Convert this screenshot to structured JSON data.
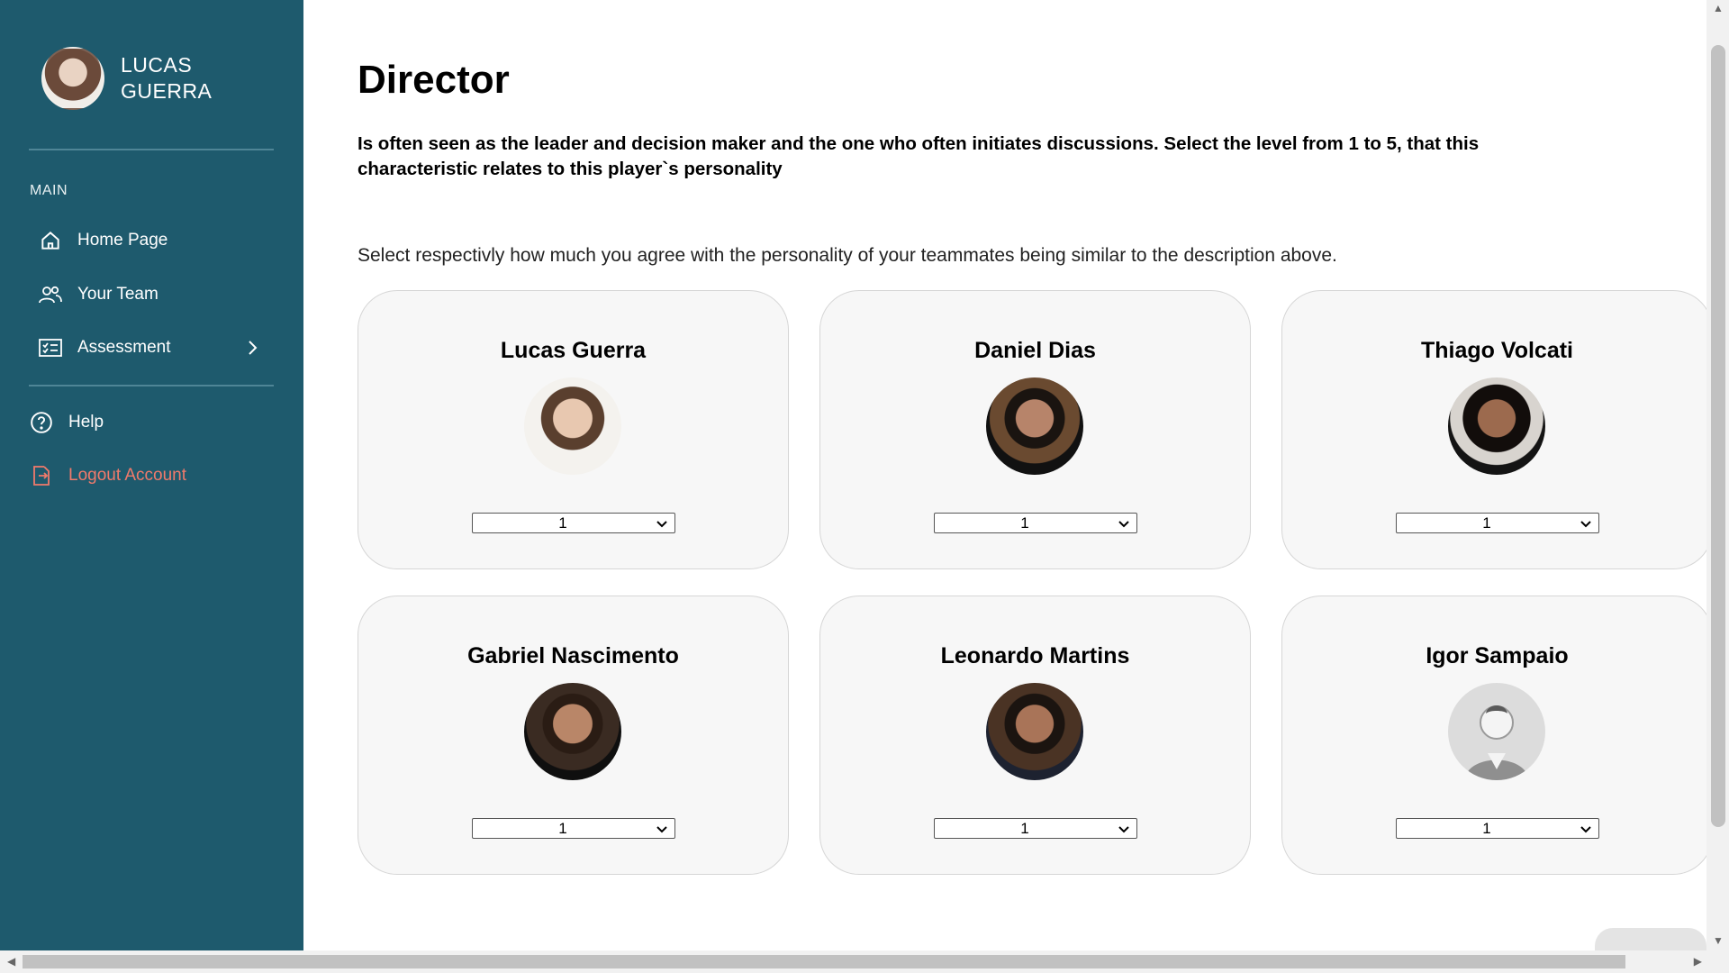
{
  "user": {
    "name": "LUCAS\nGUERRA"
  },
  "sidebar": {
    "section_label": "MAIN",
    "items": [
      {
        "label": "Home Page",
        "icon": "home-icon"
      },
      {
        "label": "Your Team",
        "icon": "team-icon"
      },
      {
        "label": "Assessment",
        "icon": "assessment-icon"
      },
      {
        "label": "Help",
        "icon": "help-icon"
      },
      {
        "label": "Logout Account",
        "icon": "logout-icon"
      }
    ]
  },
  "page": {
    "title": "Director",
    "description": "Is often seen as the leader and decision maker and the one who often initiates discussions. Select the level from 1 to 5, that this characteristic relates to this player`s personality",
    "instruction": "Select respectivly how much you agree with the personality of your teammates being similar to the description above."
  },
  "players": [
    {
      "name": "Lucas Guerra",
      "level": "1"
    },
    {
      "name": "Daniel Dias",
      "level": "1"
    },
    {
      "name": "Thiago Volcati",
      "level": "1"
    },
    {
      "name": "Gabriel Nascimento",
      "level": "1"
    },
    {
      "name": "Leonardo Martins",
      "level": "1"
    },
    {
      "name": "Igor Sampaio",
      "level": "1"
    }
  ],
  "colors": {
    "sidebar": "#1e5a6d",
    "logout": "#f07a6b",
    "card": "#f7f7f7"
  }
}
